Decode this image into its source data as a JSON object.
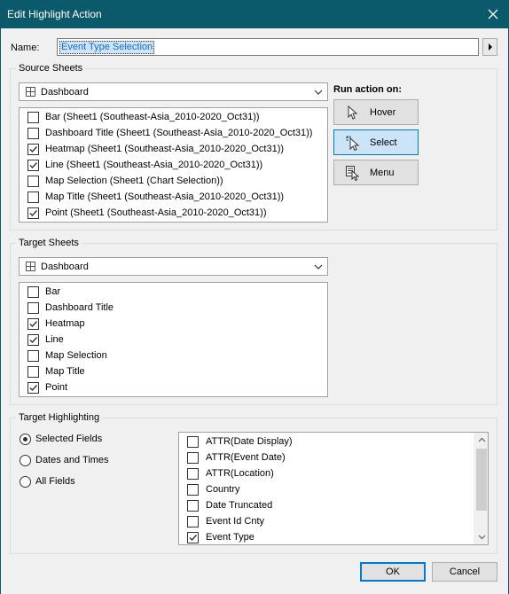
{
  "window": {
    "title": "Edit Highlight Action"
  },
  "name": {
    "label": "Name:",
    "value": "Event Type Selection"
  },
  "source": {
    "group_label": "Source Sheets",
    "combo_value": "Dashboard",
    "items": [
      {
        "label": "Bar (Sheet1 (Southeast-Asia_2010-2020_Oct31))",
        "checked": false
      },
      {
        "label": "Dashboard Title (Sheet1 (Southeast-Asia_2010-2020_Oct31))",
        "checked": false
      },
      {
        "label": "Heatmap (Sheet1 (Southeast-Asia_2010-2020_Oct31))",
        "checked": true
      },
      {
        "label": "Line (Sheet1 (Southeast-Asia_2010-2020_Oct31))",
        "checked": true
      },
      {
        "label": "Map Selection (Sheet1 (Chart Selection))",
        "checked": false
      },
      {
        "label": "Map Title (Sheet1 (Southeast-Asia_2010-2020_Oct31))",
        "checked": false
      },
      {
        "label": "Point (Sheet1 (Southeast-Asia_2010-2020_Oct31))",
        "checked": true
      }
    ]
  },
  "run_action": {
    "label": "Run action on:",
    "buttons": [
      {
        "label": "Hover",
        "icon": "pointer-arrow-icon",
        "active": false
      },
      {
        "label": "Select",
        "icon": "click-pointer-icon",
        "active": true
      },
      {
        "label": "Menu",
        "icon": "menu-pointer-icon",
        "active": false
      }
    ]
  },
  "target": {
    "group_label": "Target Sheets",
    "combo_value": "Dashboard",
    "items": [
      {
        "label": "Bar",
        "checked": false
      },
      {
        "label": "Dashboard Title",
        "checked": false
      },
      {
        "label": "Heatmap",
        "checked": true
      },
      {
        "label": "Line",
        "checked": true
      },
      {
        "label": "Map Selection",
        "checked": false
      },
      {
        "label": "Map Title",
        "checked": false
      },
      {
        "label": "Point",
        "checked": true
      }
    ]
  },
  "highlighting": {
    "group_label": "Target Highlighting",
    "options": [
      {
        "label": "Selected Fields",
        "selected": true
      },
      {
        "label": "Dates and Times",
        "selected": false
      },
      {
        "label": "All Fields",
        "selected": false
      }
    ],
    "fields": [
      {
        "label": "ATTR(Date Display)",
        "checked": false
      },
      {
        "label": "ATTR(Event Date)",
        "checked": false
      },
      {
        "label": "ATTR(Location)",
        "checked": false
      },
      {
        "label": "Country",
        "checked": false
      },
      {
        "label": "Date Truncated",
        "checked": false
      },
      {
        "label": "Event Id Cnty",
        "checked": false
      },
      {
        "label": "Event Type",
        "checked": true
      }
    ]
  },
  "buttons": {
    "ok": "OK",
    "cancel": "Cancel"
  }
}
